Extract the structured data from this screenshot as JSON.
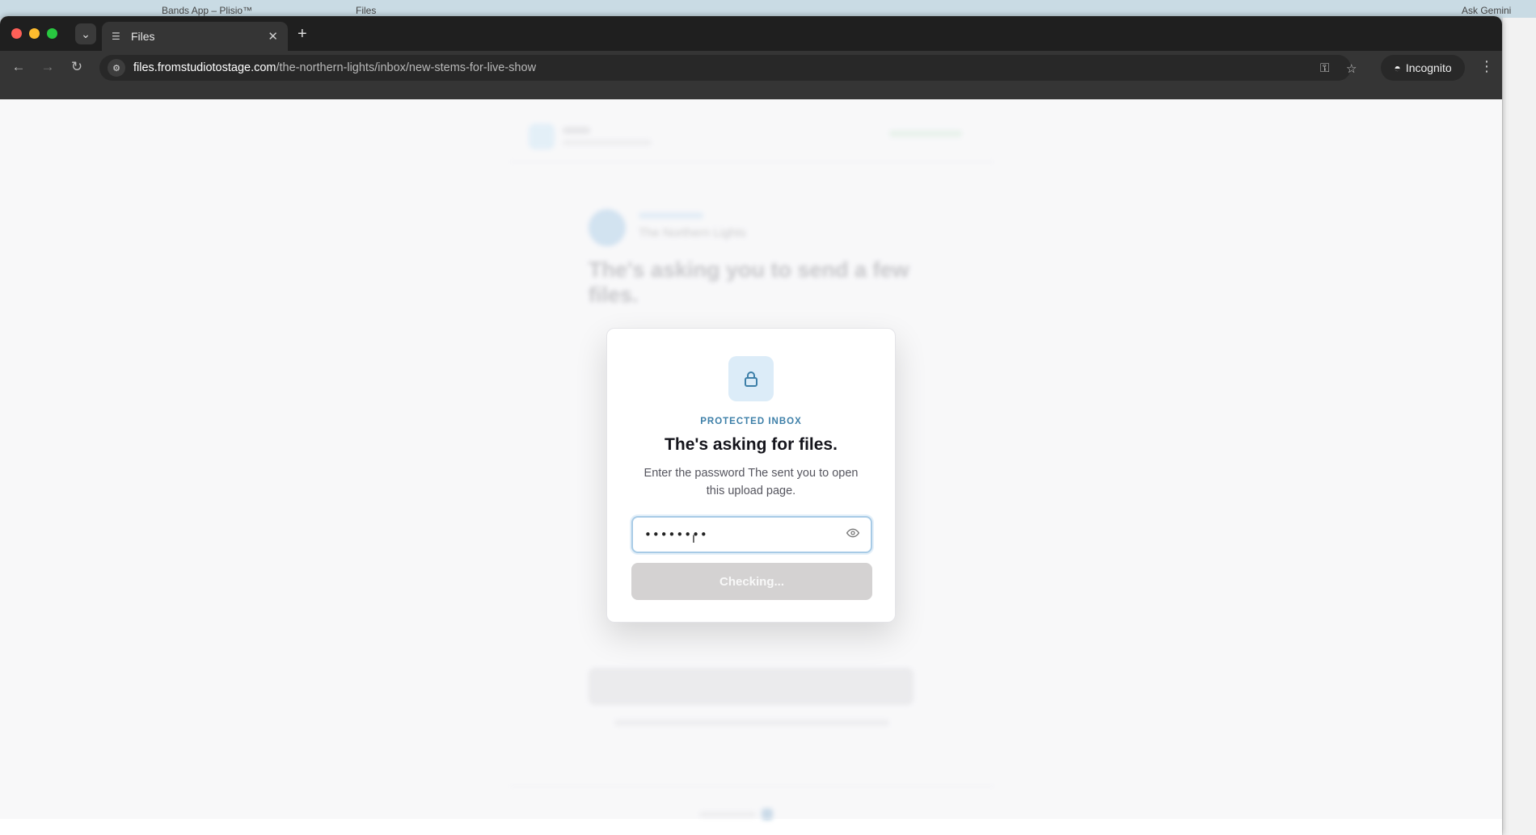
{
  "background_window": {
    "tabs": [
      "Bands App – Plisio™",
      "Files"
    ],
    "gemini": "Ask Gemini"
  },
  "browser": {
    "tab": {
      "title": "Files"
    },
    "url": {
      "host": "files.fromstudiotostage.com",
      "path": "/the-northern-lights/inbox/new-stems-for-live-show"
    },
    "incognito_label": "Incognito"
  },
  "page": {
    "band_name": "The Northern Lights",
    "heading": "The's asking you to send a few files."
  },
  "modal": {
    "eyebrow": "PROTECTED INBOX",
    "title": "The's asking for files.",
    "description": "Enter the password The sent you to open this upload page.",
    "password_value": "••••••••",
    "button_label": "Checking..."
  },
  "colors": {
    "accent": "#3d7fa8",
    "field_border": "#a8cbe6",
    "button_disabled": "#d4d2d2"
  }
}
